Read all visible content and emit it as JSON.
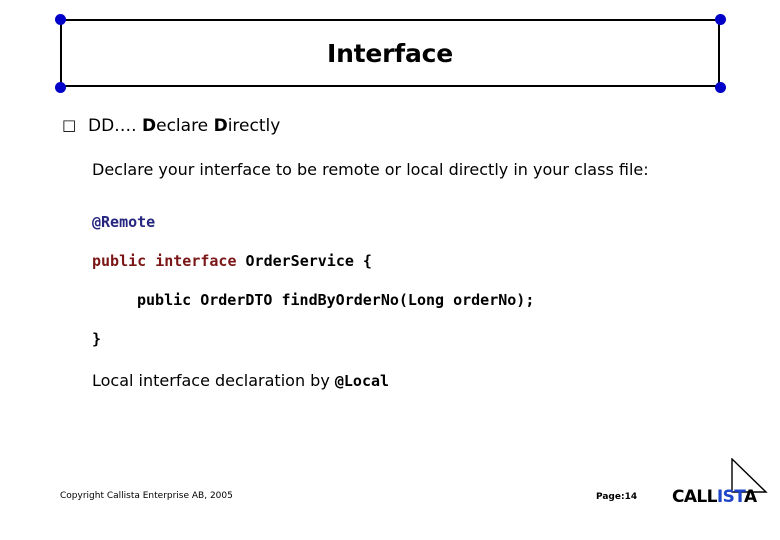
{
  "slide": {
    "title": "Interface",
    "page_label": "Page:14",
    "copyright": "Copyright Callista Enterprise AB, 2005"
  },
  "selection": {
    "handle_color": "#0000c8",
    "handles": [
      "top-left",
      "top-right",
      "bottom-left",
      "bottom-right"
    ]
  },
  "body": {
    "bullet": {
      "marker": "□",
      "prefix": "DD…. ",
      "bold_d_1": "D",
      "word_1": "eclare ",
      "bold_d_2": "D",
      "word_2": "irectly"
    },
    "intro_paragraph": "Declare your interface to be remote or local directly in your class file:",
    "outro_paragraph_text": "Local interface declaration by ",
    "outro_paragraph_code": "@Local"
  },
  "code": {
    "language": "java",
    "colors": {
      "annotation": "#26267f",
      "keyword": "#7b1616",
      "plain": "#000000"
    },
    "lines": [
      {
        "id": "line1",
        "annotation": "@Remote"
      },
      {
        "id": "line2",
        "keyword": "public interface ",
        "plain": "OrderService {"
      },
      {
        "id": "line3",
        "plain": "public OrderDTO findByOrderNo(Long orderNo);"
      },
      {
        "id": "line4",
        "plain": "}"
      }
    ]
  },
  "logo": {
    "text_part_1": "CALL",
    "text_part_2": "IST",
    "text_part_3": "A",
    "black": "#000000",
    "blue": "#1f45c8"
  }
}
